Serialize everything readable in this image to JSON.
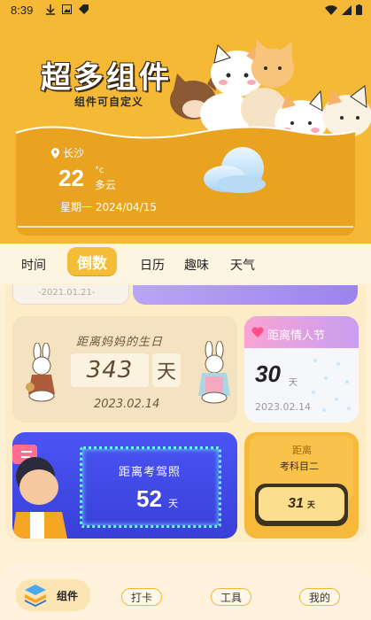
{
  "status": {
    "time": "8:39"
  },
  "hero": {
    "title": "超多组件",
    "subtitle": "组件可自定义"
  },
  "weather": {
    "location": "长沙",
    "temperature": "22",
    "unit": "°c",
    "condition": "多云",
    "date": "星期一 2024/04/15"
  },
  "tabs": [
    {
      "label": "时间"
    },
    {
      "label": "倒数"
    },
    {
      "label": "日历"
    },
    {
      "label": "趣味"
    },
    {
      "label": "天气"
    }
  ],
  "widgets": {
    "peek_date": "-2021.01.21-",
    "mom": {
      "title": "距离妈妈的生日",
      "days": "343",
      "unit": "天",
      "date": "2023.02.14"
    },
    "valentine": {
      "title": "距离情人节",
      "days": "30",
      "unit": "天",
      "date": "2023.02.14"
    },
    "driving": {
      "title": "距离考驾照",
      "days": "52",
      "unit": "天"
    },
    "exam": {
      "label": "距离",
      "subject": "考科目二",
      "days": "31",
      "unit": "天"
    }
  },
  "bottom_nav": [
    {
      "label": "组件"
    },
    {
      "label": "打卡"
    },
    {
      "label": "工具"
    },
    {
      "label": "我的"
    }
  ],
  "colors": {
    "accent": "#f5b935",
    "drive": "#4a55f4",
    "valentine": "#f9a4d3"
  }
}
